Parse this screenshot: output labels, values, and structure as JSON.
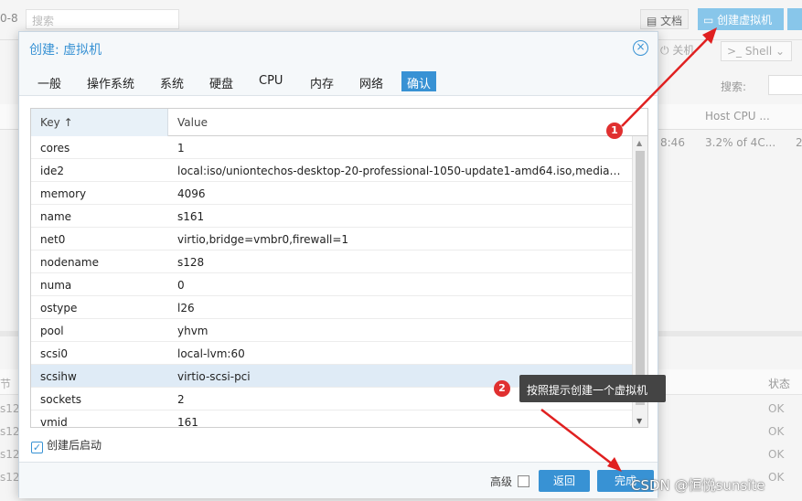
{
  "background": {
    "version_fragment": "0-8",
    "search_placeholder": "搜索",
    "doc_button": "文档",
    "create_vm_button": "创建虚拟机",
    "shutdown_button": "关机",
    "shell_button": "Shell",
    "search_label": "搜索:",
    "columns": [
      "Host CPU ..."
    ],
    "row_values": [
      "8:46",
      "3.2% of 4C...",
      "2"
    ],
    "lower_status_header": "状态",
    "lower_status_values": [
      "OK",
      "OK",
      "OK",
      "OK"
    ],
    "lower_left_fragments": [
      "节",
      "s12",
      "s12",
      "s12",
      "s12"
    ]
  },
  "dialog": {
    "title": "创建: 虚拟机",
    "tabs": [
      "一般",
      "操作系统",
      "系统",
      "硬盘",
      "CPU",
      "内存",
      "网络",
      "确认"
    ],
    "active_tab": "确认",
    "grid": {
      "key_header": "Key ↑",
      "value_header": "Value",
      "rows": [
        {
          "key": "cores",
          "value": "1"
        },
        {
          "key": "ide2",
          "value": "local:iso/uniontechos-desktop-20-professional-1050-update1-amd64.iso,media=cd..."
        },
        {
          "key": "memory",
          "value": "4096"
        },
        {
          "key": "name",
          "value": "s161"
        },
        {
          "key": "net0",
          "value": "virtio,bridge=vmbr0,firewall=1"
        },
        {
          "key": "nodename",
          "value": "s128"
        },
        {
          "key": "numa",
          "value": "0"
        },
        {
          "key": "ostype",
          "value": "l26"
        },
        {
          "key": "pool",
          "value": "yhvm"
        },
        {
          "key": "scsi0",
          "value": "local-lvm:60"
        },
        {
          "key": "scsihw",
          "value": "virtio-scsi-pci"
        },
        {
          "key": "sockets",
          "value": "2"
        },
        {
          "key": "vmid",
          "value": "161"
        }
      ],
      "selected_row": "scsihw"
    },
    "autostart_label": "创建后启动",
    "autostart_checked": true,
    "advanced_label": "高级",
    "advanced_checked": false,
    "back_button": "返回",
    "finish_button": "完成"
  },
  "annotations": {
    "badge_1": "1",
    "badge_2": "2",
    "tooltip": "按照提示创建一个虚拟机",
    "watermark": "CSDN @恒悦sunsite",
    "arrow_color": "#e02020"
  },
  "colors": {
    "accent": "#3892d4",
    "selected_row": "#dfebf6",
    "badge": "#e03030"
  }
}
